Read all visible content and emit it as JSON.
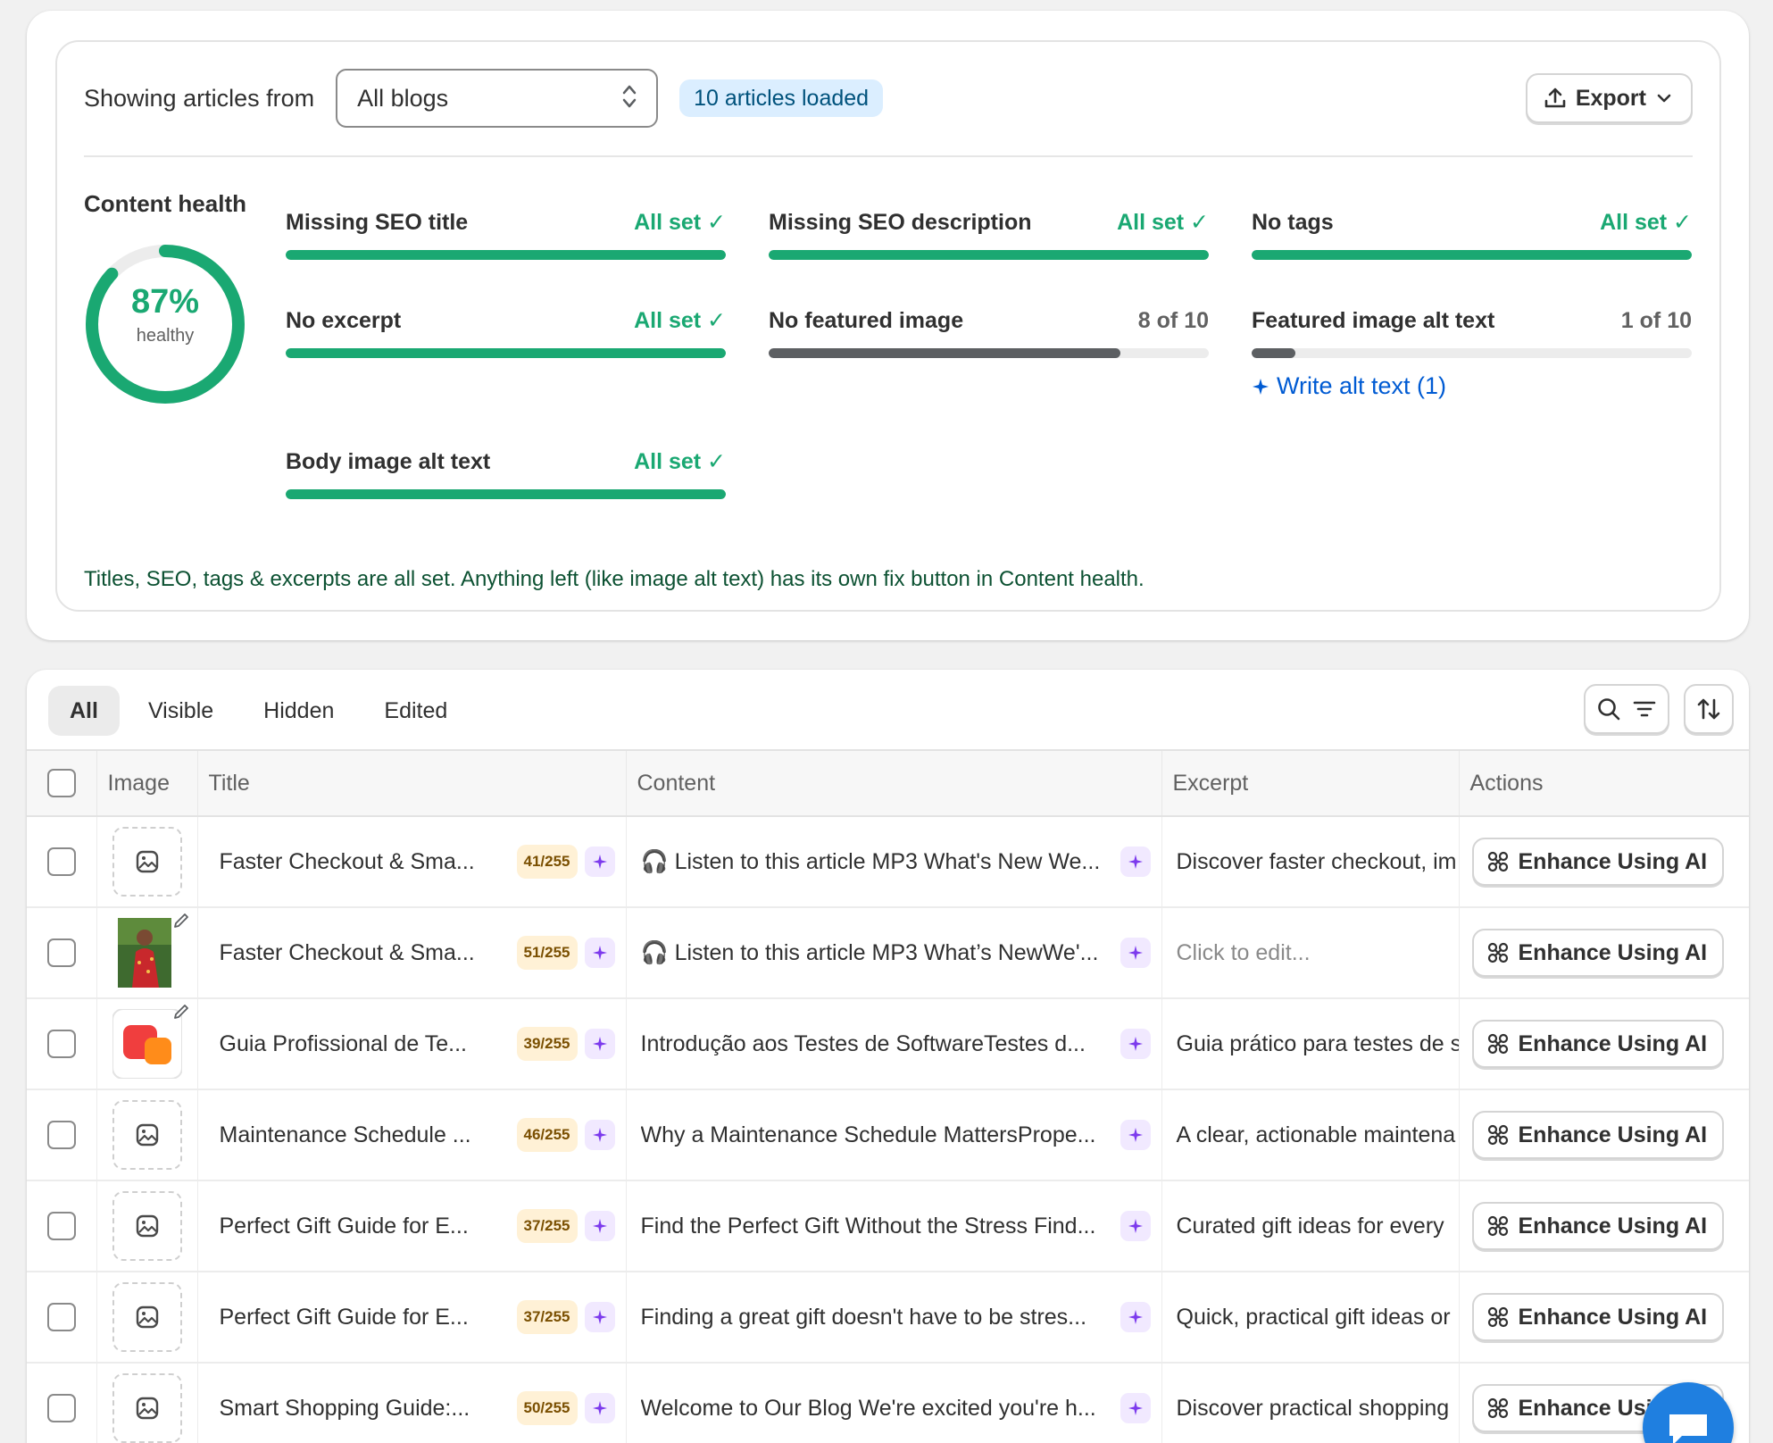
{
  "header": {
    "showing_label": "Showing articles from",
    "blog_select": "All blogs",
    "loaded_badge": "10 articles loaded",
    "export_label": "Export"
  },
  "content_health": {
    "title": "Content health",
    "percent": 87,
    "percent_label": "87%",
    "status_label": "healthy",
    "metrics": [
      {
        "label": "Missing SEO title",
        "status": "All set",
        "progress": 1.0
      },
      {
        "label": "Missing SEO description",
        "status": "All set",
        "progress": 1.0
      },
      {
        "label": "No tags",
        "status": "All set",
        "progress": 1.0
      },
      {
        "label": "No excerpt",
        "status": "All set",
        "progress": 1.0
      },
      {
        "label": "No featured image",
        "status": "8 of 10",
        "progress": 0.8
      },
      {
        "label": "Featured image alt text",
        "status": "1 of 10",
        "progress": 0.1,
        "action": "Write alt text (1)"
      },
      {
        "label": "Body image alt text",
        "status": "All set",
        "progress": 1.0
      }
    ],
    "note": "Titles, SEO, tags & excerpts are all set. Anything left (like image alt text) has its own fix button in Content health."
  },
  "tabs": [
    "All",
    "Visible",
    "Hidden",
    "Edited"
  ],
  "table": {
    "columns": [
      "Image",
      "Title",
      "Content",
      "Excerpt",
      "Actions"
    ],
    "action_label": "Enhance Using AI",
    "rows": [
      {
        "image": "placeholder",
        "title": "Faster Checkout & Sma...",
        "count": "41/255",
        "content": "🎧 Listen to this article MP3 What's New We...",
        "excerpt": "Discover faster checkout, im"
      },
      {
        "image": "photo-person",
        "title": "Faster Checkout & Sma...",
        "count": "51/255",
        "content": "🎧 Listen to this article MP3 What’s NewWe'...",
        "excerpt": "Click to edit...",
        "excerpt_placeholder": true
      },
      {
        "image": "logo-orange",
        "title": "Guia Profissional de Te...",
        "count": "39/255",
        "content": "Introdução aos Testes de SoftwareTestes d...",
        "excerpt": "Guia prático para testes de s"
      },
      {
        "image": "placeholder",
        "title": "Maintenance Schedule ...",
        "count": "46/255",
        "content": "Why a Maintenance Schedule MattersPrope...",
        "excerpt": "A clear, actionable maintena"
      },
      {
        "image": "placeholder",
        "title": "Perfect Gift Guide for E...",
        "count": "37/255",
        "content": "Find the Perfect Gift Without the Stress Find...",
        "excerpt": "Curated gift ideas for every"
      },
      {
        "image": "placeholder",
        "title": "Perfect Gift Guide for E...",
        "count": "37/255",
        "content": "Finding a great gift doesn't have to be stres...",
        "excerpt": "Quick, practical gift ideas or"
      },
      {
        "image": "placeholder",
        "title": "Smart Shopping Guide:...",
        "count": "50/255",
        "content": "Welcome to Our Blog We're excited you're h...",
        "excerpt": "Discover practical shopping"
      }
    ]
  },
  "colors": {
    "accent_green": "#1aa872",
    "link_blue": "#005bd3",
    "badge_blue": "#dbeeff",
    "sparkle_purple": "#7c3aed"
  }
}
